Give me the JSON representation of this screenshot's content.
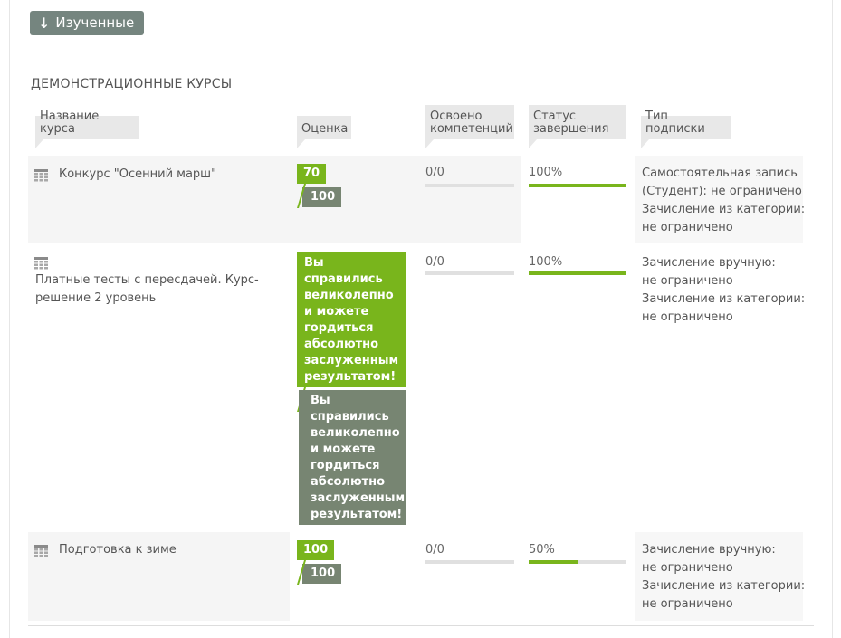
{
  "toggle": {
    "icon": "↓",
    "label": "Изученные"
  },
  "section": {
    "title": "ДЕМОНСТРАЦИОННЫЕ КУРСЫ"
  },
  "headers": {
    "course": "Название курса",
    "grade": "Оценка",
    "competencies_1": "Освоено",
    "competencies_2": "компетенций",
    "status_1": "Статус",
    "status_2": "завершения",
    "subscription": "Тип подписки"
  },
  "rows": [
    {
      "name": "Конкурс \"Осенний марш\"",
      "grade": "70",
      "max_grade": "100",
      "competencies": "0/0",
      "competencies_fraction": 0,
      "completion": "100%",
      "completion_fraction": 1.0,
      "subscription_1": "Самостоятельная запись",
      "subscription_2": "(Студент): не ограничено",
      "subscription_3": "Зачисление из категории:",
      "subscription_4": "не ограничено"
    },
    {
      "name_1": "Платные тесты с пересдачей. Курс-",
      "name_2": "решение 2 уровень",
      "grade_lines": [
        "Вы",
        "справились",
        "великолепно",
        "и можете",
        "гордиться",
        "абсолютно",
        "заслуженным",
        "результатом!"
      ],
      "max_grade_lines": [
        "Вы",
        "справились",
        "великолепно",
        "и можете",
        "гордиться",
        "абсолютно",
        "заслуженным",
        "результатом!"
      ],
      "competencies": "0/0",
      "competencies_fraction": 0,
      "completion": "100%",
      "completion_fraction": 1.0,
      "subscription_1": "Зачисление вручную:",
      "subscription_2": "не ограничено",
      "subscription_3": "Зачисление из категории:",
      "subscription_4": "не ограничено"
    },
    {
      "name": "Подготовка к зиме",
      "grade": "100",
      "max_grade": "100",
      "competencies": "0/0",
      "competencies_fraction": 0,
      "completion": "50%",
      "completion_fraction": 0.5,
      "subscription_1": "Зачисление вручную:",
      "subscription_2": "не ограничено",
      "subscription_3": "Зачисление из категории:",
      "subscription_4": "не ограничено"
    }
  ],
  "colors": {
    "accent": "#79b51c",
    "grade_gray": "#778572",
    "button": "#75857f"
  },
  "icons": {
    "course": "calendar-grid-icon",
    "toggle": "arrow-down-icon"
  }
}
